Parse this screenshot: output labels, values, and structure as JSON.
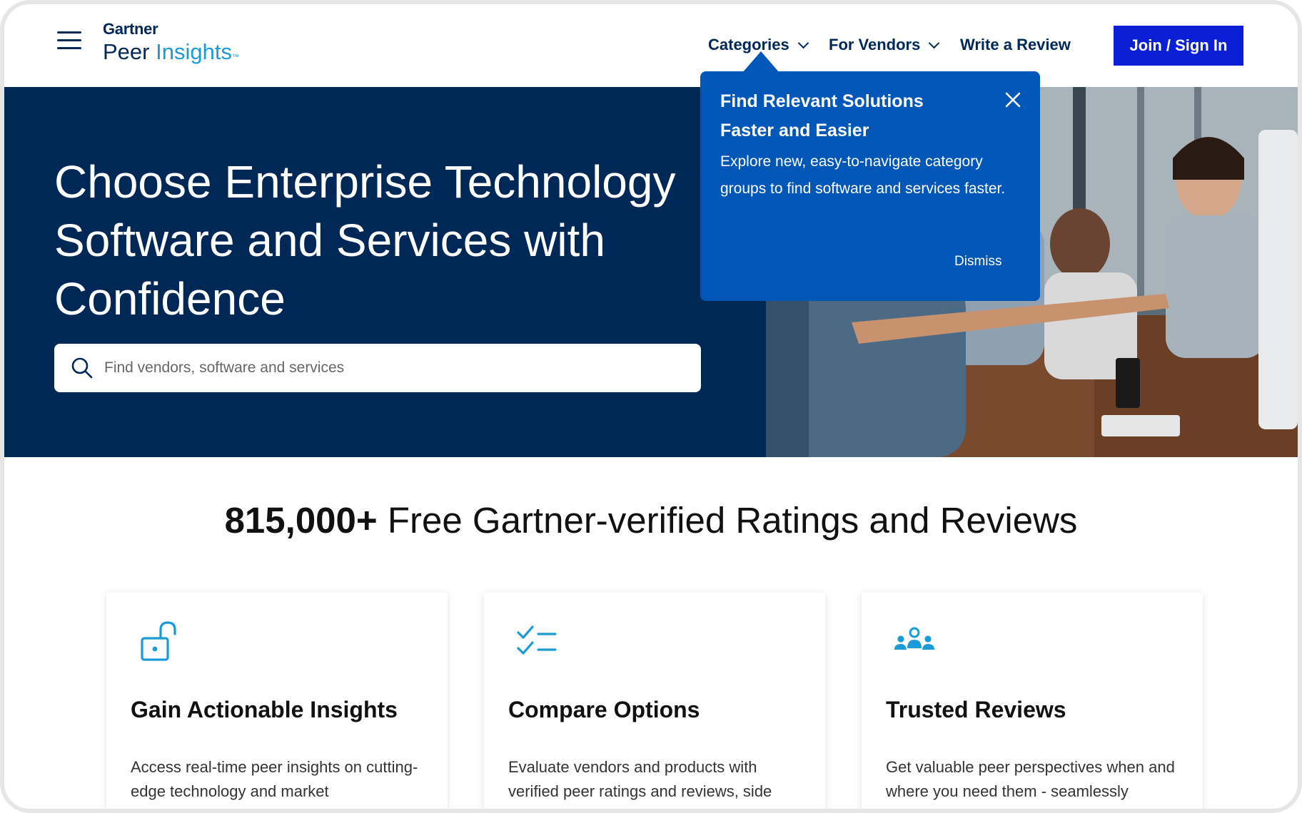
{
  "header": {
    "logo_brand": "Gartner",
    "logo_product_a": "Peer ",
    "logo_product_b": "Insights",
    "logo_tm": "™",
    "nav": {
      "categories": "Categories",
      "for_vendors": "For Vendors",
      "write_review": "Write a Review"
    },
    "join_label": "Join / Sign In",
    "accent_color": "#0a1fd6"
  },
  "hero": {
    "title": "Choose Enterprise Technology Software and Services with Confidence",
    "search_placeholder": "Find vendors, software and services",
    "background_color": "#002856"
  },
  "popover": {
    "title": "Find Relevant Solutions Faster and Easier",
    "body": "Explore new, easy-to-navigate category groups to find software and services faster.",
    "dismiss_label": "Dismiss",
    "background_color": "#0057b8"
  },
  "stats": {
    "count": "815,000+",
    "label": " Free Gartner-verified Ratings and Reviews"
  },
  "cards": [
    {
      "icon": "unlock-icon",
      "title": "Gain Actionable Insights",
      "text": "Access real-time peer insights on cutting-edge technology and market"
    },
    {
      "icon": "checklist-icon",
      "title": "Compare Options",
      "text": "Evaluate vendors and products with verified peer ratings and reviews, side"
    },
    {
      "icon": "group-icon",
      "title": "Trusted Reviews",
      "text": "Get valuable peer perspectives when and where you need them - seamlessly"
    }
  ]
}
